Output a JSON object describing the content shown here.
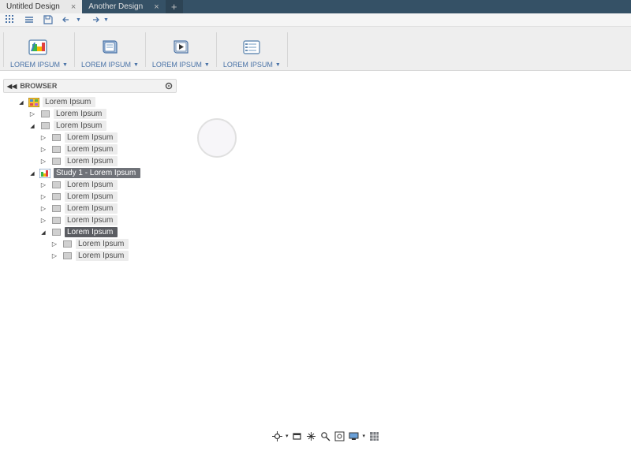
{
  "tabs": [
    {
      "label": "Untitled Design",
      "active": true
    },
    {
      "label": "Another Design",
      "active": false
    }
  ],
  "ribbon": {
    "items": [
      {
        "label": "LOREM IPSUM"
      },
      {
        "label": "LOREM IPSUM"
      },
      {
        "label": "LOREM IPSUM"
      },
      {
        "label": "LOREM IPSUM"
      }
    ]
  },
  "browser": {
    "title": "BROWSER",
    "tree": [
      {
        "id": "root",
        "depth": 0,
        "tri": "down",
        "label": "Lorem Ipsum",
        "iconType": "root"
      },
      {
        "id": "n1",
        "depth": 1,
        "tri": "right",
        "label": "Lorem Ipsum",
        "iconType": "box"
      },
      {
        "id": "n2",
        "depth": 1,
        "tri": "down",
        "label": "Lorem Ipsum",
        "iconType": "box"
      },
      {
        "id": "n2a",
        "depth": 2,
        "tri": "right",
        "label": "Lorem Ipsum",
        "iconType": "box"
      },
      {
        "id": "n2b",
        "depth": 2,
        "tri": "right",
        "label": "Lorem Ipsum",
        "iconType": "box"
      },
      {
        "id": "n2c",
        "depth": 2,
        "tri": "right",
        "label": "Lorem Ipsum",
        "iconType": "box"
      },
      {
        "id": "study",
        "depth": 1,
        "tri": "down",
        "label": "Study 1 - Lorem Ipsum",
        "iconType": "study",
        "selected": true
      },
      {
        "id": "s1",
        "depth": 2,
        "tri": "right",
        "label": "Lorem Ipsum",
        "iconType": "box"
      },
      {
        "id": "s2",
        "depth": 2,
        "tri": "right",
        "label": "Lorem Ipsum",
        "iconType": "box"
      },
      {
        "id": "s3",
        "depth": 2,
        "tri": "right",
        "label": "Lorem Ipsum",
        "iconType": "box"
      },
      {
        "id": "s4",
        "depth": 2,
        "tri": "right",
        "label": "Lorem Ipsum",
        "iconType": "box"
      },
      {
        "id": "s5",
        "depth": 2,
        "tri": "down",
        "label": "Lorem Ipsum",
        "iconType": "box",
        "seldark": true
      },
      {
        "id": "s5a",
        "depth": 3,
        "tri": "right",
        "label": "Lorem Ipsum",
        "iconType": "box"
      },
      {
        "id": "s5b",
        "depth": 3,
        "tri": "right",
        "label": "Lorem Ipsum",
        "iconType": "box"
      }
    ]
  }
}
